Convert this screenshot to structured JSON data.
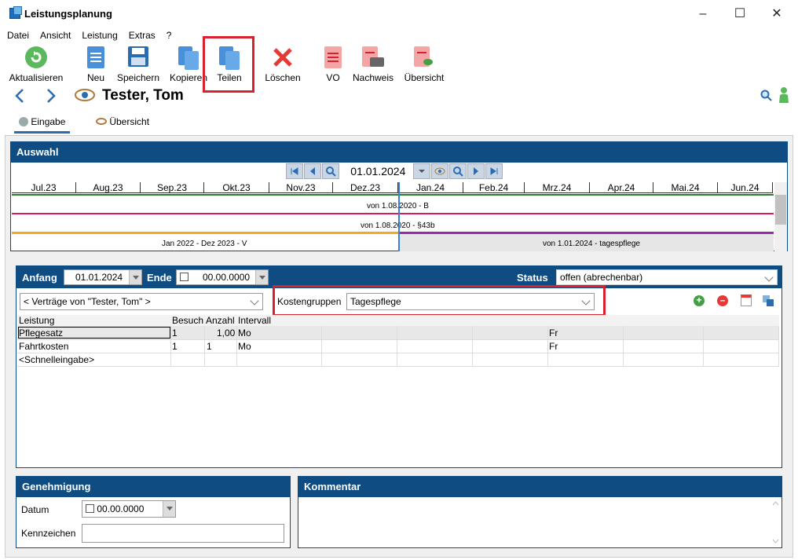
{
  "window": {
    "title": "Leistungsplanung"
  },
  "menu": [
    "Datei",
    "Ansicht",
    "Leistung",
    "Extras",
    "?"
  ],
  "toolbar": {
    "refresh": "Aktualisieren",
    "new": "Neu",
    "save": "Speichern",
    "copy": "Kopieren",
    "share": "Teilen",
    "delete": "Löschen",
    "vo": "VO",
    "proof": "Nachweis",
    "overview": "Übersicht"
  },
  "person": {
    "name": "Tester, Tom"
  },
  "tabs": [
    "Eingabe",
    "Übersicht"
  ],
  "auswahl": {
    "title": "Auswahl",
    "date": "01.01.2024",
    "months": [
      "Jul.23",
      "Aug.23",
      "Sep.23",
      "Okt.23",
      "Nov.23",
      "Dez.23",
      "Jan.24",
      "Feb.24",
      "Mrz.24",
      "Apr.24",
      "Mai.24",
      "Jun.24"
    ],
    "bar1": "von 1.08.2020 - B",
    "bar2": "von 1.08.2020 - §43b",
    "bar3a": "Jan 2022 - Dez 2023 - V",
    "bar3b": "von 1.01.2024 - tagespflege",
    "colors": {
      "green": "#2e7d32",
      "pink": "#d81b60",
      "orange": "#f5a623",
      "purple": "#9c27b0",
      "today": "#3b7fd4"
    }
  },
  "form": {
    "anfang_label": "Anfang",
    "anfang": "01.01.2024",
    "ende_label": "Ende",
    "ende": "00.00.0000",
    "status_label": "Status",
    "status": "offen (abrechenbar)",
    "vertraege": "< Verträge von \"Tester, Tom\" >",
    "kosten_label": "Kostengruppen",
    "kosten": "Tagespflege"
  },
  "table": {
    "headers": [
      "Leistung",
      "Besuch",
      "Anzahl",
      "Intervall"
    ],
    "rows": [
      [
        "Pflegesatz",
        "1",
        "1,00",
        "Mo",
        "Fr"
      ],
      [
        "Fahrtkosten",
        "1",
        "1",
        "Mo",
        "Fr"
      ],
      [
        "<Schnelleingabe>",
        "",
        "",
        "",
        ""
      ]
    ]
  },
  "genehmigung": {
    "title": "Genehmigung",
    "datum_label": "Datum",
    "datum": "00.00.0000",
    "kennzeichen_label": "Kennzeichen",
    "kennzeichen": ""
  },
  "kommentar": {
    "title": "Kommentar"
  }
}
